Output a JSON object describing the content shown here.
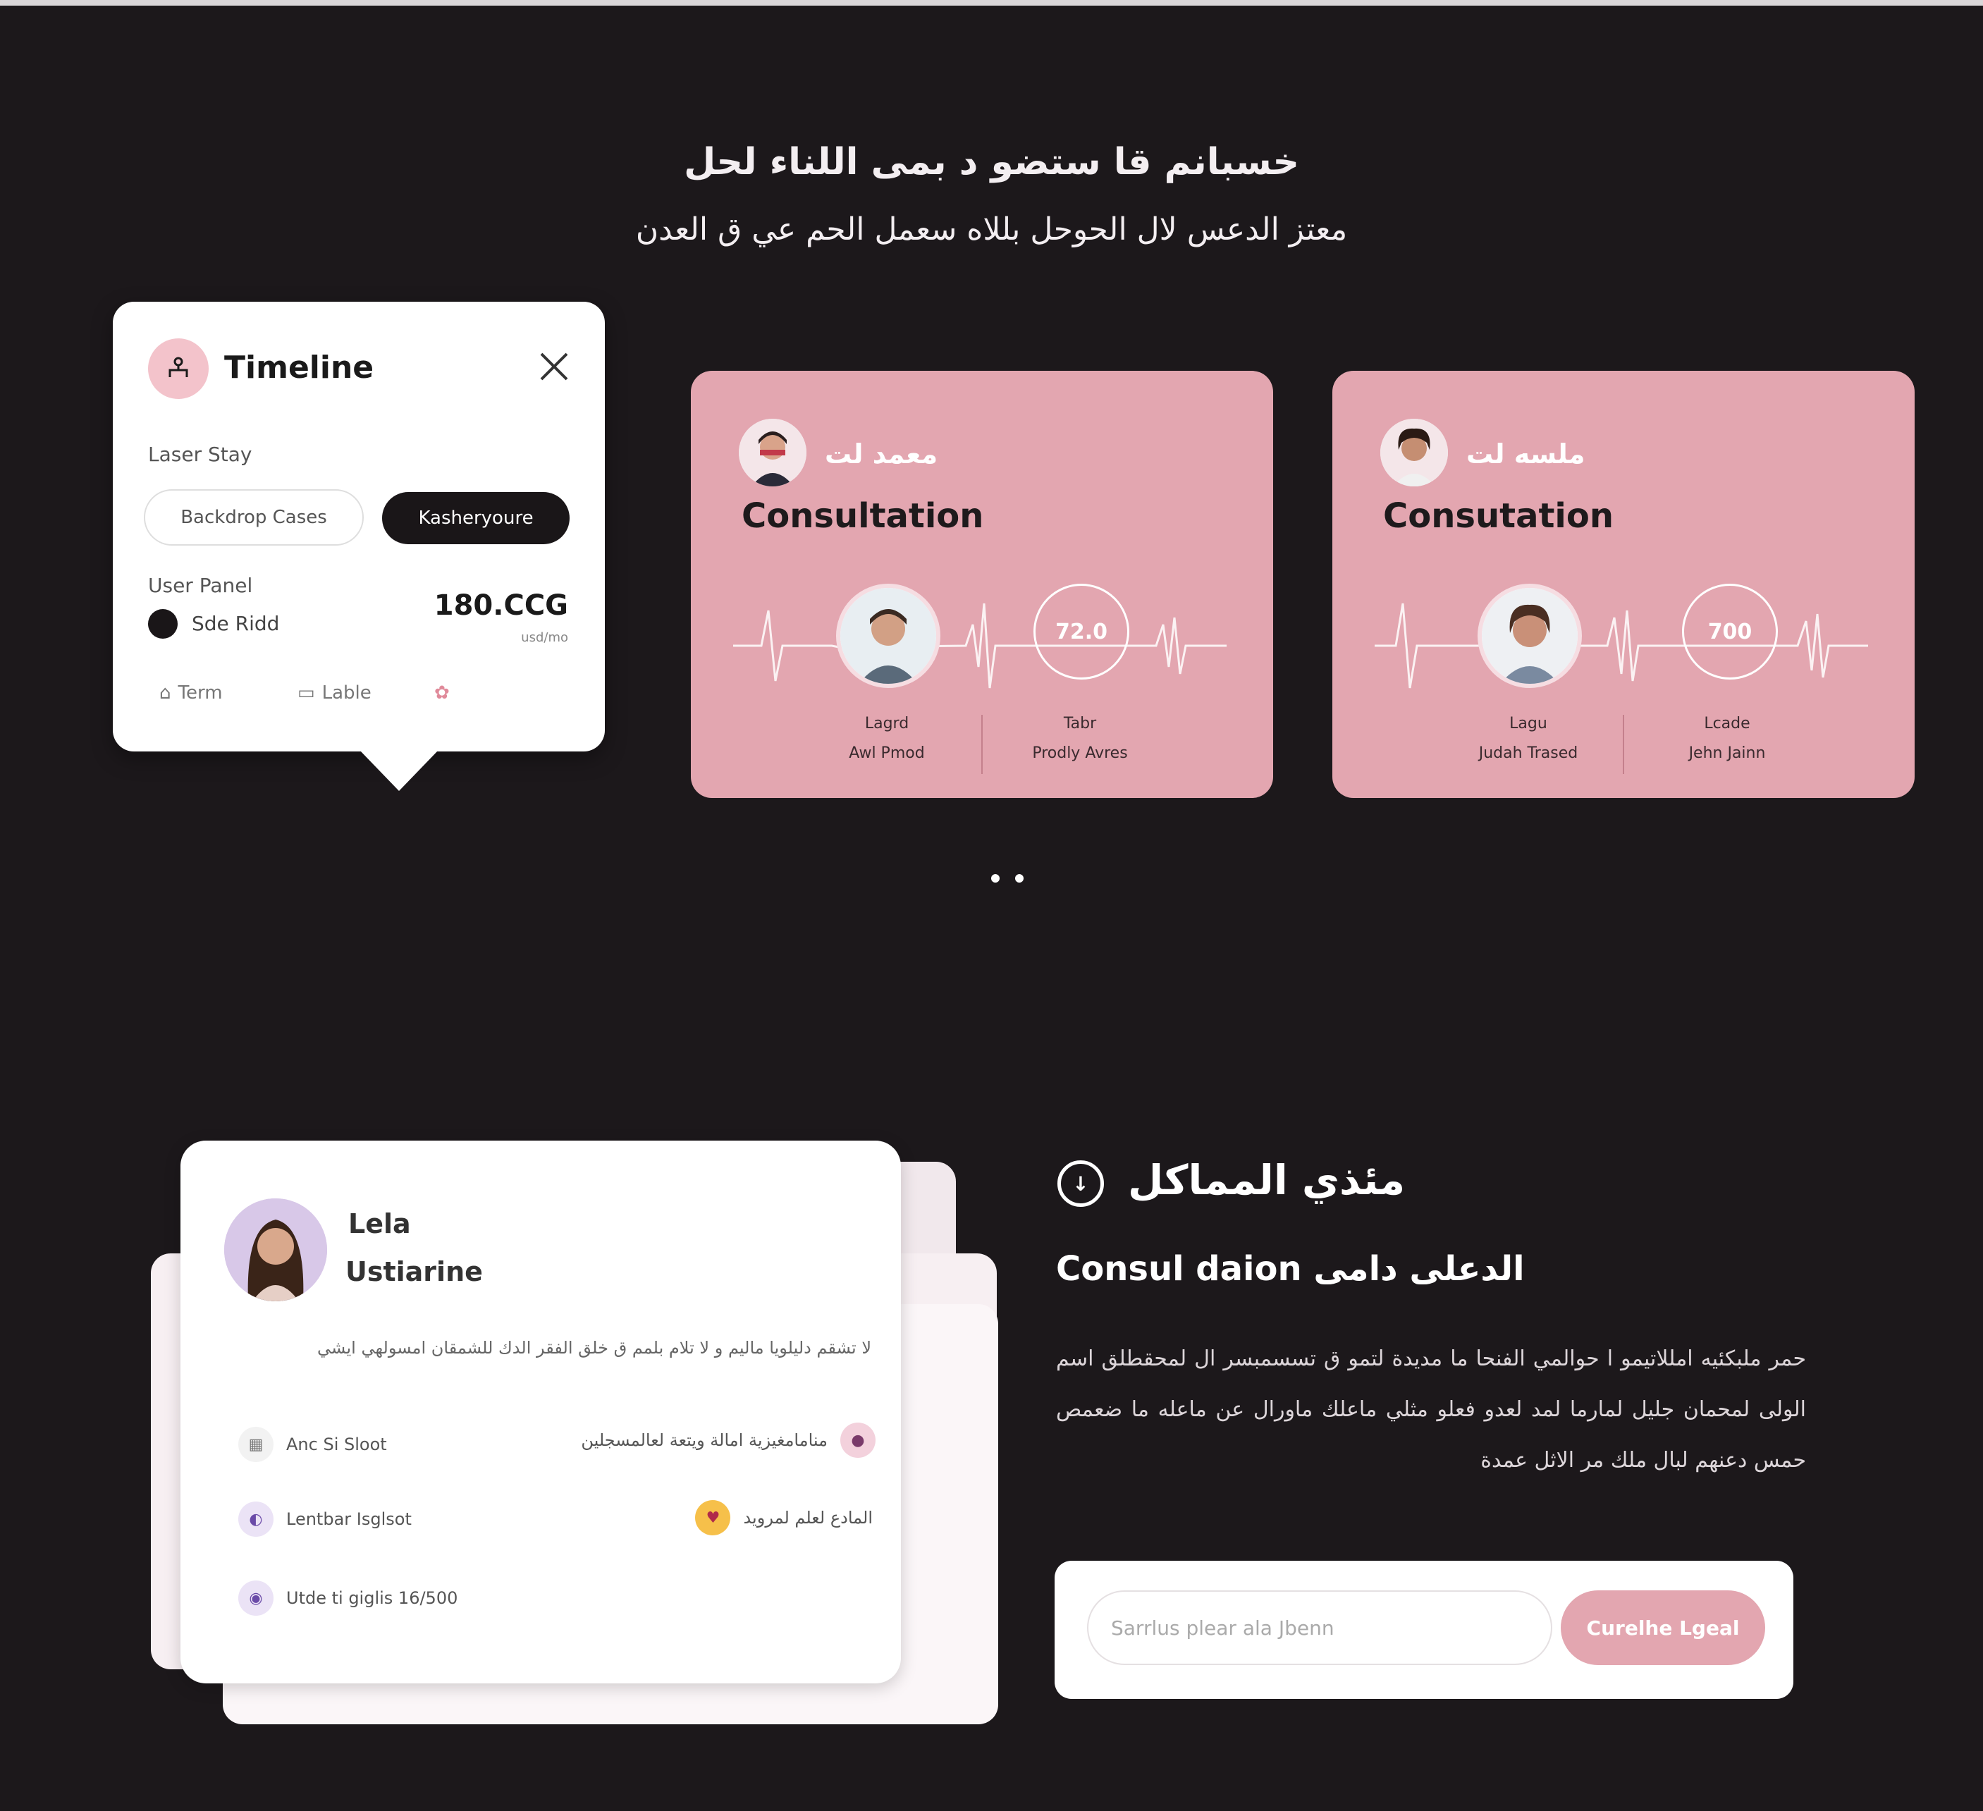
{
  "hero": {
    "line1": "خسبانم قا ستضو د بمى اللناء لحل",
    "line2": "معتز الدعس لال الحوحل بللاه سعمل الحم عي ق العدن"
  },
  "timeline": {
    "title": "Timeline",
    "label_primary": "Laser Stay",
    "button_secondary": "Backdrop Cases",
    "button_primary": "Kasheryoure",
    "label_user": "User Panel",
    "user_name": "Sde Ridd",
    "amount": "180.CCG",
    "amount_caption": "usd/mo",
    "footer": [
      "Term",
      "Lable"
    ]
  },
  "consultation_cards": [
    {
      "name": "معمد لت",
      "title": "Consultation",
      "ring_value": "72.0",
      "stat_left": [
        "Lagrd",
        "Awl Pmod"
      ],
      "stat_right": [
        "Tabr",
        "Prodly Avres"
      ]
    },
    {
      "name": "ملسه لت",
      "title": "Consutation",
      "ring_value": "700",
      "stat_left": [
        "Lagu",
        "Judah Trased"
      ],
      "stat_right": [
        "Lcade",
        "Jehn Jainn"
      ]
    }
  ],
  "profile": {
    "first_name": "Lela",
    "last_name": "Ustiarine",
    "description": "لا تشقم دليلويا ماليم و لا تلام بلمم ق خلق الفقر الدك للشمقان امسولهي ايشي",
    "items": [
      {
        "label": "Anc Si Sloot"
      },
      {
        "label": "Lentbar Isglsot"
      },
      {
        "label": "Utde ti giglis 16/500"
      },
      {
        "label": "منامامغيزية امالة ويتعة لعالمسجلين"
      },
      {
        "label": "المادع لعلم لمرويد"
      }
    ]
  },
  "section": {
    "heading": "مئذي المماكل",
    "subheading": "Consul daion الدعلى دامى",
    "paragraph": "حمر ملبكئيه امللاتيمو ا حوالمي الفنحا ما مديدة لتمو ق تسسمبسر ال لمحقطلق اسم الولى لمحمان جليل لمارما لمد لعدو فعلو مثلي ماعلك ماورال عن ماعله ما ضعمص حمس دعنهم لبال ملك مر الاثل عمدة",
    "input_placeholder": "Sarrlus plear ala Jbenn",
    "button_label": "Curelhe Lgeal"
  },
  "colors": {
    "background": "#1c181b",
    "card_pink": "#e3a6b0",
    "dark_button": "#1a1618"
  }
}
